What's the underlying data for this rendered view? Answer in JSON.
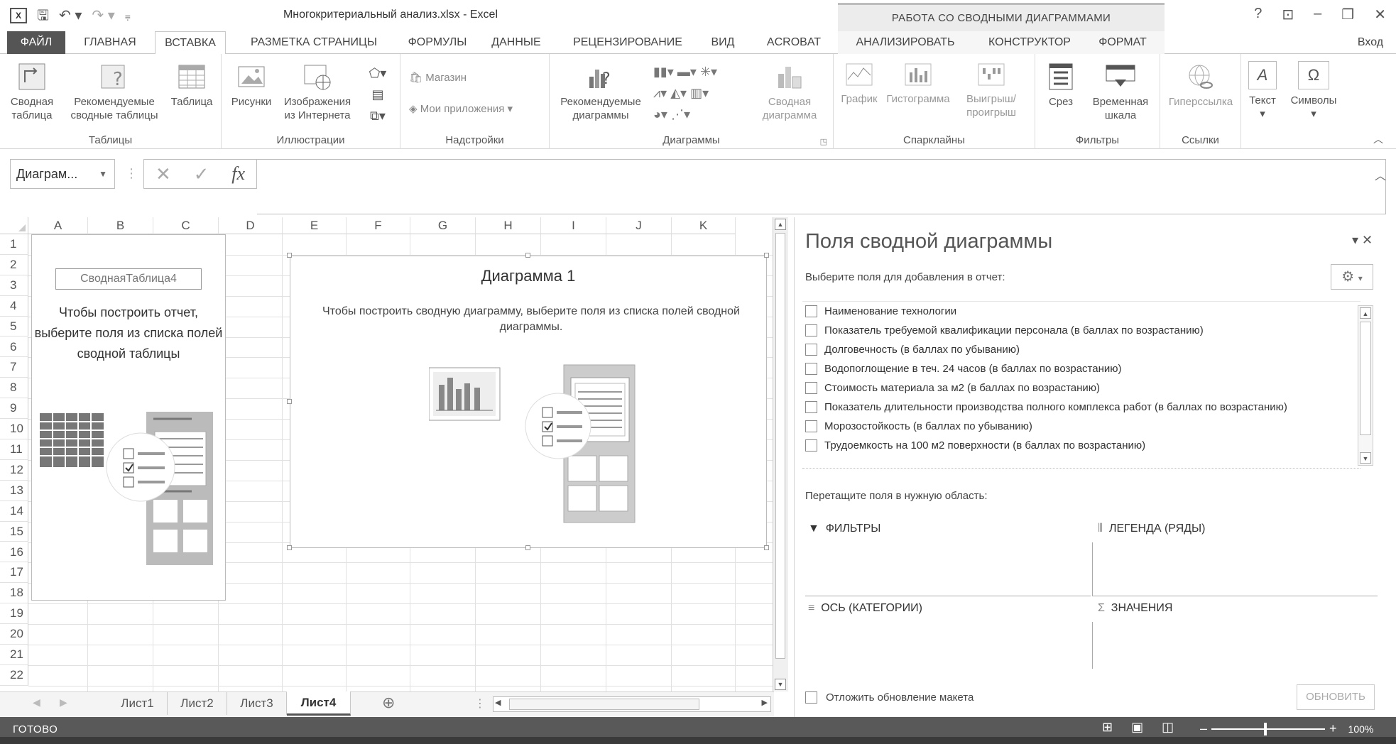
{
  "titlebar": {
    "doc_title": "Многокритериальный анализ.xlsx - Excel",
    "context_header": "РАБОТА СО СВОДНЫМИ ДИАГРАММАМИ",
    "sign_in": "Вход",
    "help": "?"
  },
  "tabs": [
    {
      "label": "ФАЙЛ"
    },
    {
      "label": "ГЛАВНАЯ"
    },
    {
      "label": "ВСТАВКА"
    },
    {
      "label": "РАЗМЕТКА СТРАНИЦЫ"
    },
    {
      "label": "ФОРМУЛЫ"
    },
    {
      "label": "ДАННЫЕ"
    },
    {
      "label": "РЕЦЕНЗИРОВАНИЕ"
    },
    {
      "label": "ВИД"
    },
    {
      "label": "ACROBAT"
    },
    {
      "label": "АНАЛИЗИРОВАТЬ"
    },
    {
      "label": "КОНСТРУКТОР"
    },
    {
      "label": "ФОРМАТ"
    }
  ],
  "ribbon": {
    "tables": {
      "label": "Таблицы",
      "pivot": "Сводная\nтаблица",
      "recommended": "Рекомендуемые\nсводные таблицы",
      "table": "Таблица"
    },
    "illustrations": {
      "label": "Иллюстрации",
      "pictures": "Рисунки",
      "online": "Изображения\nиз Интернета"
    },
    "addins": {
      "label": "Надстройки",
      "store": "Магазин",
      "my_apps": "Мои приложения"
    },
    "charts": {
      "label": "Диаграммы",
      "recommended": "Рекомендуемые\nдиаграммы",
      "pivot_chart": "Сводная\nдиаграмма"
    },
    "sparklines": {
      "label": "Спарклайны",
      "line": "График",
      "column": "Гистограмма",
      "winloss": "Выигрыш/\nпроигрыш"
    },
    "filters": {
      "label": "Фильтры",
      "slicer": "Срез",
      "timeline": "Временная\nшкала"
    },
    "links": {
      "label": "Ссылки",
      "hyperlink": "Гиперссылка"
    },
    "text": {
      "label": "Текст",
      "symbols": "Символы"
    }
  },
  "formula_bar": {
    "name_box": "Диаграм...",
    "fx": "fx",
    "cancel": "✕",
    "enter": "✓"
  },
  "grid": {
    "columns": [
      "A",
      "B",
      "C",
      "D",
      "E",
      "F",
      "G",
      "H",
      "I",
      "J",
      "K"
    ],
    "rows": [
      "1",
      "2",
      "3",
      "4",
      "5",
      "6",
      "7",
      "8",
      "9",
      "10",
      "11",
      "12",
      "13",
      "14",
      "15",
      "16",
      "17",
      "18",
      "19",
      "20",
      "21",
      "22"
    ]
  },
  "pivot_placeholder": {
    "name": "СводнаяТаблица4",
    "instruction": "Чтобы построить отчет, выберите поля из списка полей сводной таблицы"
  },
  "chart": {
    "title": "Диаграмма 1",
    "instruction": "Чтобы построить сводную диаграмму, выберите поля из списка полей сводной диаграммы."
  },
  "sheets": [
    "Лист1",
    "Лист2",
    "Лист3",
    "Лист4"
  ],
  "active_sheet": "Лист4",
  "pane": {
    "title": "Поля сводной диаграммы",
    "choose": "Выберите поля для добавления в отчет:",
    "fields": [
      "Наименование технологии",
      "Показатель требуемой квалификации персонала (в баллах по возрастанию)",
      "Долговечность (в баллах по убыванию)",
      "Водопоглощение в теч. 24 часов (в баллах по возрастанию)",
      "Стоимость материала за м2 (в баллах по возрастанию)",
      "Показатель длительности производства полного комплекса работ (в баллах по возрастанию)",
      "Морозостойкость (в баллах по убыванию)",
      "Трудоемкость на 100 м2 поверхности (в баллах по возрастанию)"
    ],
    "drag": "Перетащите поля в нужную область:",
    "areas": {
      "filters": "ФИЛЬТРЫ",
      "legend": "ЛЕГЕНДА (РЯДЫ)",
      "axis": "ОСЬ (КАТЕГОРИИ)",
      "values": "ЗНАЧЕНИЯ"
    },
    "defer": "Отложить обновление макета",
    "update": "ОБНОВИТЬ"
  },
  "status": {
    "text": "ГОТОВО",
    "zoom": "100%"
  }
}
